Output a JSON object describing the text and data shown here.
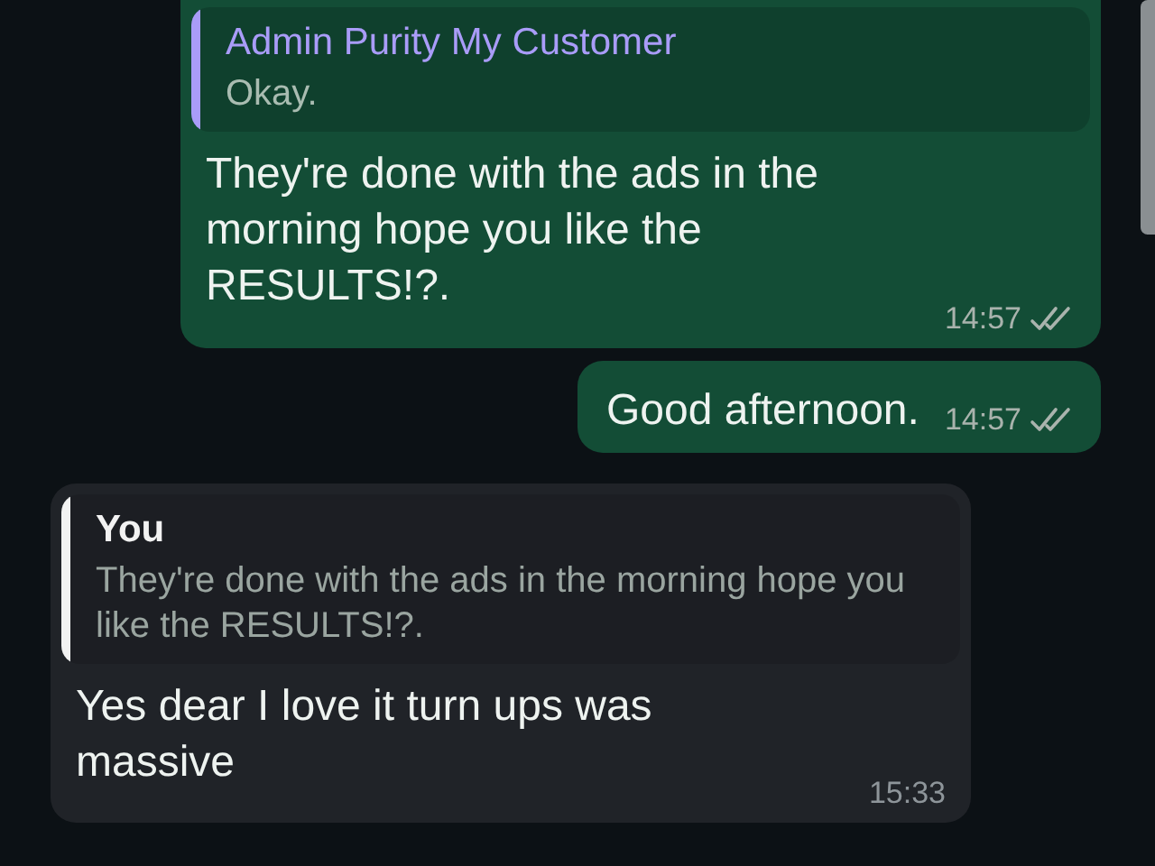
{
  "messages": [
    {
      "kind": "outgoing",
      "quote": {
        "author": "Admin Purity My Customer",
        "text": "Okay.",
        "color": "#a99cf8"
      },
      "text": "They're done with the ads in the morning hope you like the RESULTS!?.",
      "time": "14:57",
      "read": false
    },
    {
      "kind": "outgoing",
      "text": "Good afternoon.",
      "time": "14:57",
      "read": false
    },
    {
      "kind": "incoming",
      "quote": {
        "author": "You",
        "text": "They're done with the ads in the morning hope you like the RESULTS!?.",
        "color": "#f2f2f2"
      },
      "text": "Yes dear I love it turn ups was massive",
      "time": "15:33"
    }
  ]
}
